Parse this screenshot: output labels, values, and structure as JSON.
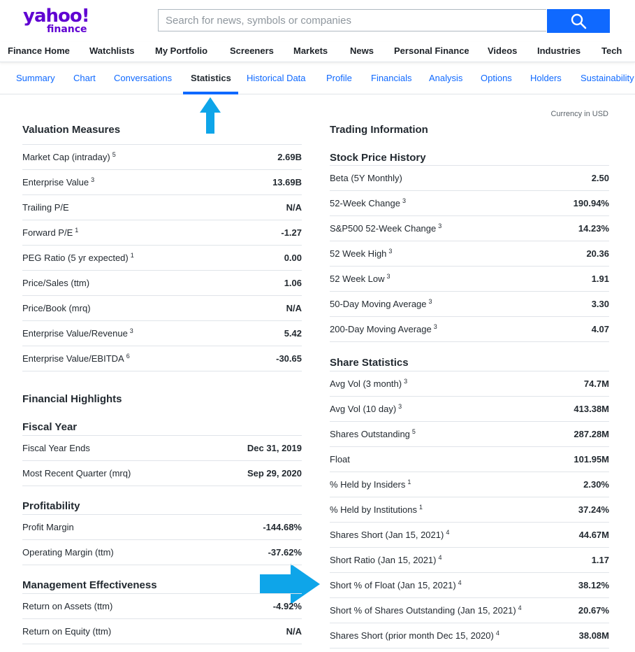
{
  "header": {
    "logo_text": "yahoo!",
    "logo_sub": "finance",
    "search_placeholder": "Search for news, symbols or companies",
    "search_icon": "search-icon",
    "brand_color": "#6001d2",
    "accent_color": "#0f69ff"
  },
  "nav": [
    "Finance Home",
    "Watchlists",
    "My Portfolio",
    "Screeners",
    "Markets",
    "News",
    "Personal Finance",
    "Videos",
    "Industries",
    "Tech"
  ],
  "tabs": [
    "Summary",
    "Chart",
    "Conversations",
    "Statistics",
    "Historical Data",
    "Profile",
    "Financials",
    "Analysis",
    "Options",
    "Holders",
    "Sustainability"
  ],
  "active_tab": "Statistics",
  "currency_note": "Currency in USD",
  "left": {
    "valuation": {
      "title": "Valuation Measures",
      "rows": [
        {
          "label": "Market Cap (intraday)",
          "sup": "5",
          "value": "2.69B"
        },
        {
          "label": "Enterprise Value",
          "sup": "3",
          "value": "13.69B"
        },
        {
          "label": "Trailing P/E",
          "sup": "",
          "value": "N/A"
        },
        {
          "label": "Forward P/E",
          "sup": "1",
          "value": "-1.27"
        },
        {
          "label": "PEG Ratio (5 yr expected)",
          "sup": "1",
          "value": "0.00"
        },
        {
          "label": "Price/Sales (ttm)",
          "sup": "",
          "value": "1.06"
        },
        {
          "label": "Price/Book (mrq)",
          "sup": "",
          "value": "N/A"
        },
        {
          "label": "Enterprise Value/Revenue",
          "sup": "3",
          "value": "5.42"
        },
        {
          "label": "Enterprise Value/EBITDA",
          "sup": "6",
          "value": "-30.65"
        }
      ]
    },
    "highlights_title": "Financial Highlights",
    "fiscal_year": {
      "title": "Fiscal Year",
      "rows": [
        {
          "label": "Fiscal Year Ends",
          "sup": "",
          "value": "Dec 31, 2019"
        },
        {
          "label": "Most Recent Quarter (mrq)",
          "sup": "",
          "value": "Sep 29, 2020"
        }
      ]
    },
    "profitability": {
      "title": "Profitability",
      "rows": [
        {
          "label": "Profit Margin",
          "sup": "",
          "value": "-144.68%"
        },
        {
          "label": "Operating Margin (ttm)",
          "sup": "",
          "value": "-37.62%"
        }
      ]
    },
    "management": {
      "title": "Management Effectiveness",
      "rows": [
        {
          "label": "Return on Assets (ttm)",
          "sup": "",
          "value": "-4.92%"
        },
        {
          "label": "Return on Equity (ttm)",
          "sup": "",
          "value": "N/A"
        }
      ]
    }
  },
  "right": {
    "trading_title": "Trading Information",
    "price_history": {
      "title": "Stock Price History",
      "rows": [
        {
          "label": "Beta (5Y Monthly)",
          "sup": "",
          "value": "2.50"
        },
        {
          "label": "52-Week Change",
          "sup": "3",
          "value": "190.94%"
        },
        {
          "label": "S&P500 52-Week Change",
          "sup": "3",
          "value": "14.23%"
        },
        {
          "label": "52 Week High",
          "sup": "3",
          "value": "20.36"
        },
        {
          "label": "52 Week Low",
          "sup": "3",
          "value": "1.91"
        },
        {
          "label": "50-Day Moving Average",
          "sup": "3",
          "value": "3.30"
        },
        {
          "label": "200-Day Moving Average",
          "sup": "3",
          "value": "4.07"
        }
      ]
    },
    "share_statistics": {
      "title": "Share Statistics",
      "rows": [
        {
          "label": "Avg Vol (3 month)",
          "sup": "3",
          "value": "74.7M"
        },
        {
          "label": "Avg Vol (10 day)",
          "sup": "3",
          "value": "413.38M"
        },
        {
          "label": "Shares Outstanding",
          "sup": "5",
          "value": "287.28M"
        },
        {
          "label": "Float",
          "sup": "",
          "value": "101.95M"
        },
        {
          "label": "% Held by Insiders",
          "sup": "1",
          "value": "2.30%"
        },
        {
          "label": "% Held by Institutions",
          "sup": "1",
          "value": "37.24%"
        },
        {
          "label": "Shares Short (Jan 15, 2021)",
          "sup": "4",
          "value": "44.67M"
        },
        {
          "label": "Short Ratio (Jan 15, 2021)",
          "sup": "4",
          "value": "1.17"
        },
        {
          "label": "Short % of Float (Jan 15, 2021)",
          "sup": "4",
          "value": "38.12%"
        },
        {
          "label": "Short % of Shares Outstanding (Jan 15, 2021)",
          "sup": "4",
          "value": "20.67%"
        },
        {
          "label": "Shares Short (prior month Dec 15, 2020)",
          "sup": "4",
          "value": "38.08M"
        }
      ]
    }
  },
  "annotations": {
    "arrow_color": "#0ea5e9",
    "up_arrow_icon": "up-arrow-icon",
    "right_arrow_icon": "right-arrow-icon"
  }
}
